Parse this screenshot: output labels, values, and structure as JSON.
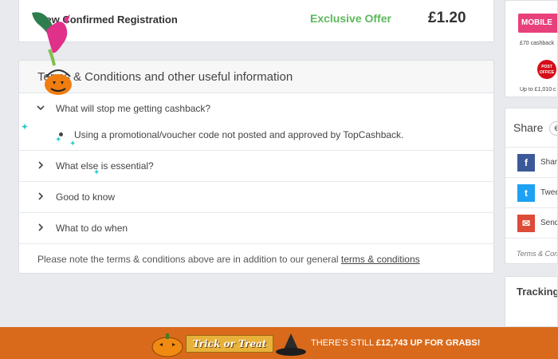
{
  "offer": {
    "name": "New Confirmed Registration",
    "tag": "Exclusive Offer",
    "amount": "£1.20"
  },
  "terms": {
    "title": "Terms & Conditions and other useful information",
    "items": [
      {
        "label": "What will stop me getting cashback?",
        "expanded": true,
        "bullet": "Using a promotional/voucher code not posted and approved by TopCashback."
      },
      {
        "label": "What else is essential?",
        "expanded": false
      },
      {
        "label": "Good to know",
        "expanded": false
      },
      {
        "label": "What to do when",
        "expanded": false
      }
    ],
    "note_prefix": "Please note the terms & conditions above are in addition to our general ",
    "note_link": "terms & conditions"
  },
  "sidebar": {
    "promo": {
      "badge": "MOBILE",
      "cashback_1": "£70 cashback",
      "po_logo": "POST OFFICE",
      "cashback_2": "Up to £1,010 c"
    },
    "share": {
      "title": "Share",
      "circle": "€",
      "items": [
        {
          "label": "Share",
          "icon": "facebook-icon",
          "color": "#3b5998",
          "glyph": "f"
        },
        {
          "label": "Twee",
          "icon": "twitter-icon",
          "color": "#1da1f2",
          "glyph": "t"
        },
        {
          "label": "Send",
          "icon": "mail-icon",
          "color": "#dd4b39",
          "glyph": "✉"
        }
      ],
      "footer": "Terms & Cond"
    },
    "tracking": {
      "title": "Tracking"
    }
  },
  "banner": {
    "trick": "Trick or Treat",
    "text_prefix": "THERE'S STILL ",
    "amount": "£12,743",
    "text_suffix": " UP FOR GRABS!",
    "bg": "#d96a1b"
  }
}
